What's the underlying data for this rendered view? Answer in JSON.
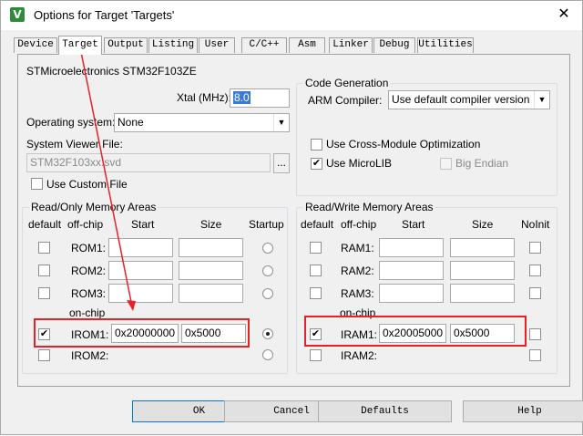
{
  "window": {
    "title": "Options for Target 'Targets'",
    "app_icon_glyph": "V",
    "close_glyph": "✕"
  },
  "tabs": [
    {
      "label": "Device",
      "active": false
    },
    {
      "label": "Target",
      "active": true
    },
    {
      "label": "Output",
      "active": false
    },
    {
      "label": "Listing",
      "active": false
    },
    {
      "label": "User",
      "active": false
    },
    {
      "label": "C/C++",
      "active": false
    },
    {
      "label": "Asm",
      "active": false
    },
    {
      "label": "Linker",
      "active": false
    },
    {
      "label": "Debug",
      "active": false
    },
    {
      "label": "Utilities",
      "active": false
    }
  ],
  "device": {
    "name": "STMicroelectronics STM32F103ZE"
  },
  "xtal": {
    "label": "Xtal (MHz):",
    "value": "8.0"
  },
  "os": {
    "label": "Operating system:",
    "value": "None"
  },
  "svd": {
    "label": "System Viewer File:",
    "value": "STM32F103xx.svd",
    "browse": "...",
    "custom_label": "Use Custom File"
  },
  "codegen": {
    "title": "Code Generation",
    "compiler_label": "ARM Compiler:",
    "compiler_value": "Use default compiler version",
    "cross_module": "Use Cross-Module Optimization",
    "microlib": "Use MicroLIB",
    "big_endian": "Big Endian"
  },
  "ro_mem": {
    "title": "Read/Only Memory Areas",
    "headers": {
      "default": "default",
      "offchip": "off-chip",
      "start": "Start",
      "size": "Size",
      "startup": "Startup"
    },
    "onchip_label": "on-chip",
    "rows": [
      {
        "label": "ROM1:",
        "start": "",
        "size": "",
        "default": false,
        "startup": false
      },
      {
        "label": "ROM2:",
        "start": "",
        "size": "",
        "default": false,
        "startup": false
      },
      {
        "label": "ROM3:",
        "start": "",
        "size": "",
        "default": false,
        "startup": false
      },
      {
        "label": "IROM1:",
        "start": "0x20000000",
        "size": "0x5000",
        "default": true,
        "startup": true
      },
      {
        "label": "IROM2:",
        "start": "",
        "size": "",
        "default": false,
        "startup": false
      }
    ]
  },
  "rw_mem": {
    "title": "Read/Write Memory Areas",
    "headers": {
      "default": "default",
      "offchip": "off-chip",
      "start": "Start",
      "size": "Size",
      "noinit": "NoInit"
    },
    "onchip_label": "on-chip",
    "rows": [
      {
        "label": "RAM1:",
        "start": "",
        "size": "",
        "default": false,
        "noinit": false
      },
      {
        "label": "RAM2:",
        "start": "",
        "size": "",
        "default": false,
        "noinit": false
      },
      {
        "label": "RAM3:",
        "start": "",
        "size": "",
        "default": false,
        "noinit": false
      },
      {
        "label": "IRAM1:",
        "start": "0x20005000",
        "size": "0x5000",
        "default": true,
        "noinit": false
      },
      {
        "label": "IRAM2:",
        "start": "",
        "size": "",
        "default": false,
        "noinit": false
      }
    ]
  },
  "buttons": {
    "ok": "OK",
    "cancel": "Cancel",
    "defaults": "Defaults",
    "help": "Help"
  },
  "check_glyph": "✔",
  "colors": {
    "annotation": "#e8202a",
    "selection": "#3b7ad8",
    "panel": "#f0f0f0"
  }
}
